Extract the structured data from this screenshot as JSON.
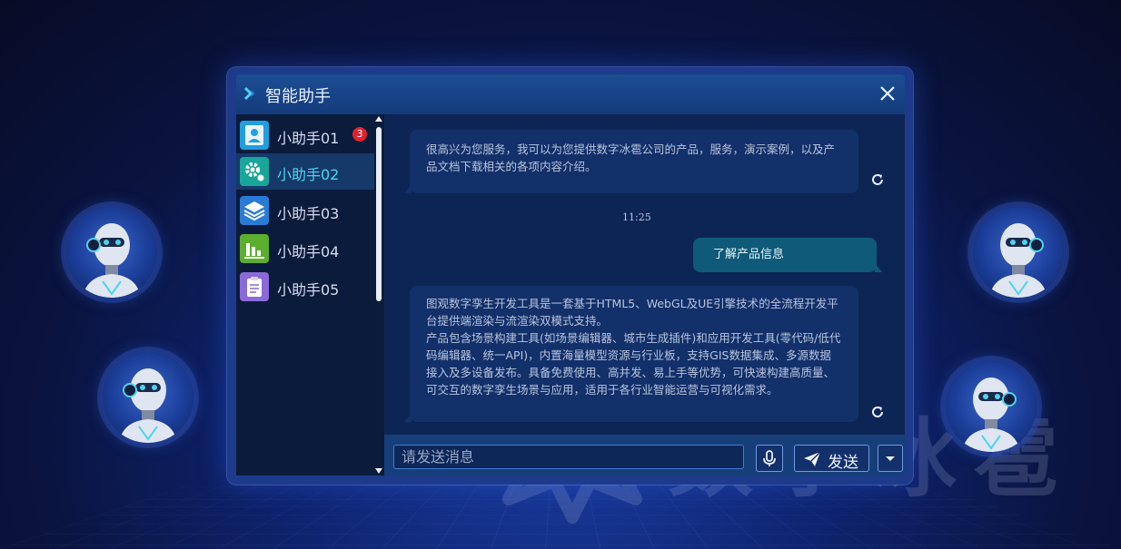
{
  "window": {
    "title": "智能助手"
  },
  "watermark": {
    "text": "数字冰雹"
  },
  "contacts": [
    {
      "name": "小助手01",
      "badge": "3",
      "icon": "user-card-icon",
      "color": "#1f9fe0"
    },
    {
      "name": "小助手02",
      "badge": "",
      "icon": "gear-icon",
      "color": "#1aa59a"
    },
    {
      "name": "小助手03",
      "badge": "",
      "icon": "layers-icon",
      "color": "#2a7bd6"
    },
    {
      "name": "小助手04",
      "badge": "",
      "icon": "bar-chart-icon",
      "color": "#5cae2e"
    },
    {
      "name": "小助手05",
      "badge": "",
      "icon": "clipboard-icon",
      "color": "#8a6ad8"
    }
  ],
  "active_contact": "小助手02",
  "messages": [
    {
      "from": "assistant",
      "text": "很高兴为您服务，我可以为您提供数字冰雹公司的产品，服务，演示案例，以及产品文档下载相关的各项内容介绍。"
    },
    {
      "type": "timestamp",
      "text": "11:25"
    },
    {
      "from": "user",
      "text": "了解产品信息"
    },
    {
      "from": "assistant",
      "paragraphs": [
        "图观数字孪生开发工具是一套基于HTML5、WebGL及UE引擎技术的全流程开发平台提供端渲染与流渲染双模式支持。",
        "产品包含场景构建工具(如场景编辑器、城市生成插件)和应用开发工具(零代码/低代码编辑器、统一API)，内置海量模型资源与行业板，支持GIS数据集成、多源数据接入及多设备发布。具备免费使用、高并发、易上手等优势，可快速构建高质量、可交互的数字孪生场景与应用，适用于各行业智能运营与可视化需求。"
      ]
    }
  ],
  "input": {
    "placeholder": "请发送消息",
    "value": ""
  },
  "actions": {
    "send_label": "发送"
  },
  "colors": {
    "accent": "#4fd3ee",
    "badge": "#e3202e",
    "user_bubble": "#0e5a78"
  }
}
